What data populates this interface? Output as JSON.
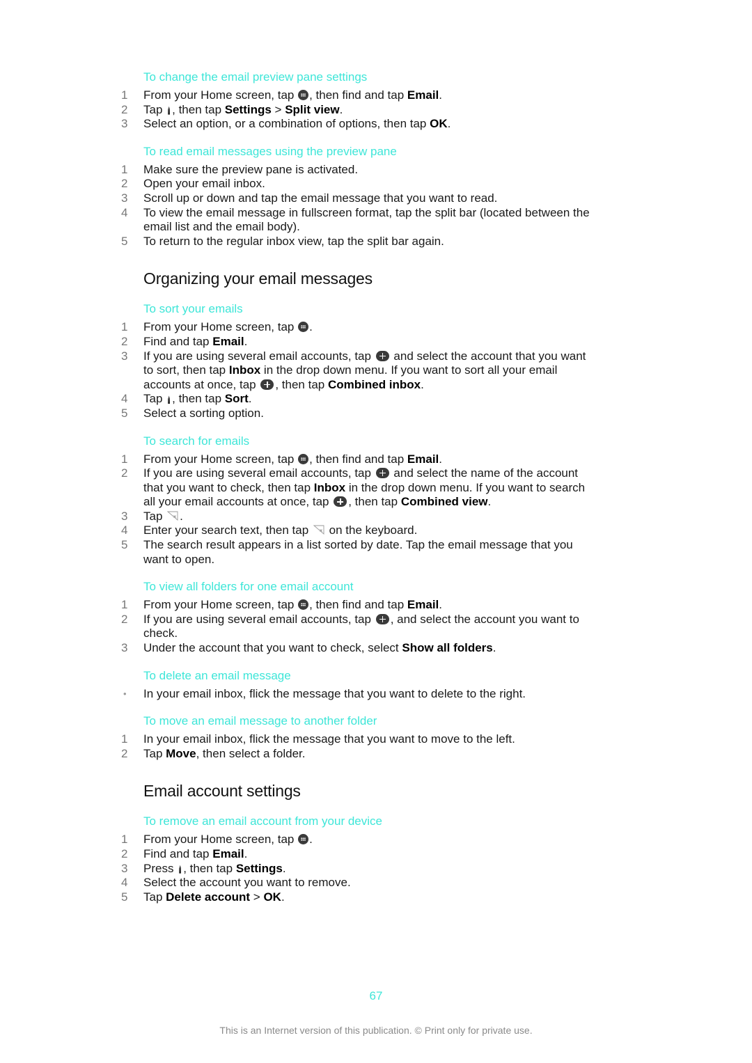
{
  "accent_color": "#3ee6d8",
  "sections": {
    "preview_settings": {
      "title": "To change the email preview pane settings",
      "steps": [
        {
          "num": "1",
          "a": "From your Home screen, tap ",
          "icon": "apps-icon",
          "b": ", then find and tap ",
          "bold1": "Email",
          "c": "."
        },
        {
          "num": "2",
          "a": "Tap ",
          "icon": "menu-icon",
          "b": ", then tap ",
          "bold1": "Settings",
          "sep": " > ",
          "bold2": "Split view",
          "c": "."
        },
        {
          "num": "3",
          "a": "Select an option, or a combination of options, then tap ",
          "bold1": "OK",
          "c": "."
        }
      ]
    },
    "read_preview": {
      "title": "To read email messages using the preview pane",
      "steps": [
        {
          "num": "1",
          "text": "Make sure the preview pane is activated."
        },
        {
          "num": "2",
          "text": "Open your email inbox."
        },
        {
          "num": "3",
          "text": "Scroll up or down and tap the email message that you want to read."
        },
        {
          "num": "4",
          "text": "To view the email message in fullscreen format, tap the split bar (located between the email list and the email body)."
        },
        {
          "num": "5",
          "text": "To return to the regular inbox view, tap the split bar again."
        }
      ]
    },
    "organizing": {
      "heading": "Organizing your email messages"
    },
    "sort": {
      "title": "To sort your emails",
      "steps": [
        {
          "num": "1",
          "a": "From your Home screen, tap ",
          "c": "."
        },
        {
          "num": "2",
          "a": "Find and tap ",
          "bold1": "Email",
          "c": "."
        },
        {
          "num": "3",
          "a": "If you are using several email accounts, tap ",
          "b": " and select the account that you want to sort, then tap ",
          "bold1": "Inbox",
          "d": " in the drop down menu. If you want to sort all your email accounts at once, tap ",
          "e": ", then tap ",
          "bold2": "Combined inbox",
          "c": "."
        },
        {
          "num": "4",
          "a": "Tap ",
          "b": ", then tap ",
          "bold1": "Sort",
          "c": "."
        },
        {
          "num": "5",
          "text": "Select a sorting option."
        }
      ]
    },
    "search": {
      "title": "To search for emails",
      "steps": [
        {
          "num": "1",
          "a": "From your Home screen, tap ",
          "b": ", then find and tap ",
          "bold1": "Email",
          "c": "."
        },
        {
          "num": "2",
          "a": "If you are using several email accounts, tap ",
          "b": " and select the name of the account that you want to check, then tap ",
          "bold1": "Inbox",
          "d": " in the drop down menu. If you want to search all your email accounts at once, tap ",
          "e": ", then tap ",
          "bold2": "Combined view",
          "c": "."
        },
        {
          "num": "3",
          "a": "Tap ",
          "c": "."
        },
        {
          "num": "4",
          "a": "Enter your search text, then tap ",
          "b": " on the keyboard."
        },
        {
          "num": "5",
          "text": "The search result appears in a list sorted by date. Tap the email message that you want to open."
        }
      ]
    },
    "folders": {
      "title": "To view all folders for one email account",
      "steps": [
        {
          "num": "1",
          "a": "From your Home screen, tap ",
          "b": ", then find and tap ",
          "bold1": "Email",
          "c": "."
        },
        {
          "num": "2",
          "a": "If you are using several email accounts, tap ",
          "b": ", and select the account you want to check."
        },
        {
          "num": "3",
          "a": "Under the account that you want to check, select ",
          "bold1": "Show all folders",
          "c": "."
        }
      ]
    },
    "delete": {
      "title": "To delete an email message",
      "bullet": "•",
      "text": "In your email inbox, flick the message that you want to delete to the right."
    },
    "move": {
      "title": "To move an email message to another folder",
      "steps": [
        {
          "num": "1",
          "text": "In your email inbox, flick the message that you want to move to the left."
        },
        {
          "num": "2",
          "a": "Tap ",
          "bold1": "Move",
          "c": ", then select a folder."
        }
      ]
    },
    "account_settings": {
      "heading": "Email account settings"
    },
    "remove": {
      "title": "To remove an email account from your device",
      "steps": [
        {
          "num": "1",
          "a": "From your Home screen, tap ",
          "c": "."
        },
        {
          "num": "2",
          "a": "Find and tap ",
          "bold1": "Email",
          "c": "."
        },
        {
          "num": "3",
          "a": "Press ",
          "b": ", then tap ",
          "bold1": "Settings",
          "c": "."
        },
        {
          "num": "4",
          "text": "Select the account you want to remove."
        },
        {
          "num": "5",
          "a": "Tap ",
          "bold1": "Delete account",
          "sep": " > ",
          "bold2": "OK",
          "c": "."
        }
      ]
    }
  },
  "footer": {
    "page_number": "67",
    "note": "This is an Internet version of this publication. © Print only for private use."
  }
}
